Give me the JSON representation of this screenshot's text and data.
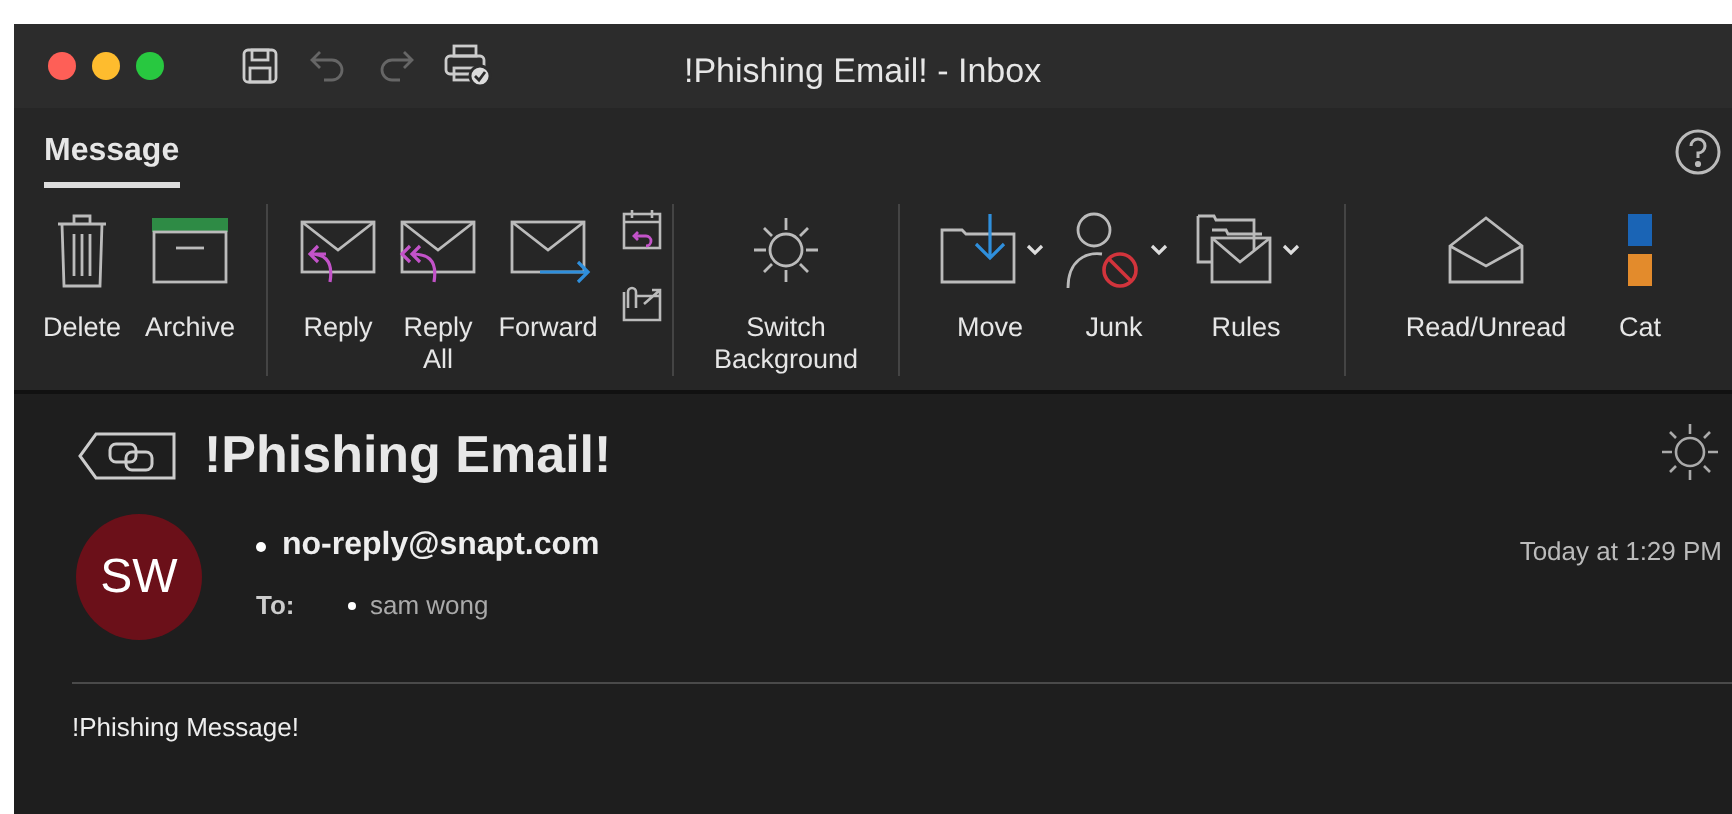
{
  "window": {
    "title": "!Phishing Email! - Inbox"
  },
  "tabs": [
    {
      "label": "Message",
      "selected": true
    }
  ],
  "ribbon": {
    "groups": [
      [
        {
          "label": "Delete",
          "dropdown": false
        },
        {
          "label": "Archive",
          "dropdown": false
        }
      ],
      [
        {
          "label": "Reply",
          "dropdown": false
        },
        {
          "label": "Reply All",
          "dropdown": false
        },
        {
          "label": "Forward",
          "dropdown": false
        }
      ],
      [
        {
          "label": "Switch Background",
          "dropdown": false
        }
      ],
      [
        {
          "label": "Move",
          "dropdown": true
        },
        {
          "label": "Junk",
          "dropdown": true
        },
        {
          "label": "Rules",
          "dropdown": true
        }
      ],
      [
        {
          "label": "Read/Unread",
          "dropdown": false
        },
        {
          "label": "Cat",
          "dropdown": false
        }
      ]
    ]
  },
  "message": {
    "subject": "!Phishing Email!",
    "avatar": "SW",
    "sender": "no-reply@snapt.com",
    "to_label": "To:",
    "recipient": "sam wong",
    "time": "Today at 1:29 PM",
    "body": "!Phishing Message!"
  }
}
